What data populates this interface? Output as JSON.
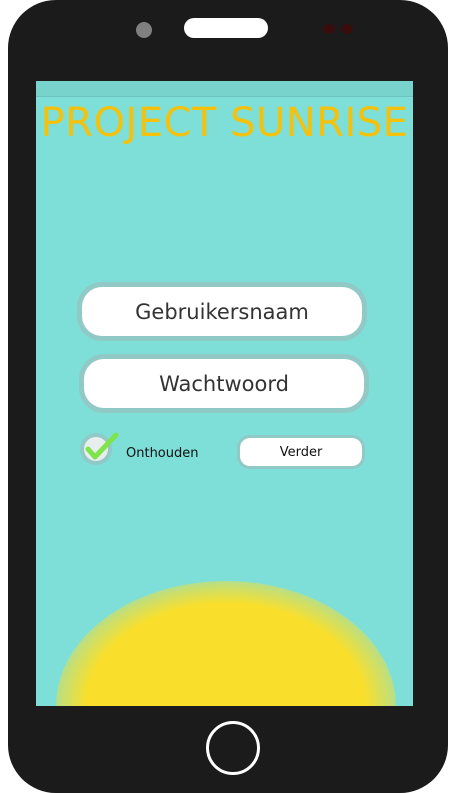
{
  "app": {
    "title": "PROJECT SUNRISE"
  },
  "login": {
    "username_label": "Gebruikersnaam",
    "password_label": "Wachtwoord",
    "remember_label": "Onthouden",
    "remember_checked": true,
    "next_label": "Verder"
  },
  "colors": {
    "screen_bg": "#7ddfd8",
    "title": "#f4c20c",
    "sun": "#f9df2c",
    "phone_body": "#1b1b1b",
    "check": "#7fe34a"
  },
  "icons": [
    "camera-icon",
    "speaker-icon",
    "checkmark-icon",
    "home-button-icon"
  ]
}
